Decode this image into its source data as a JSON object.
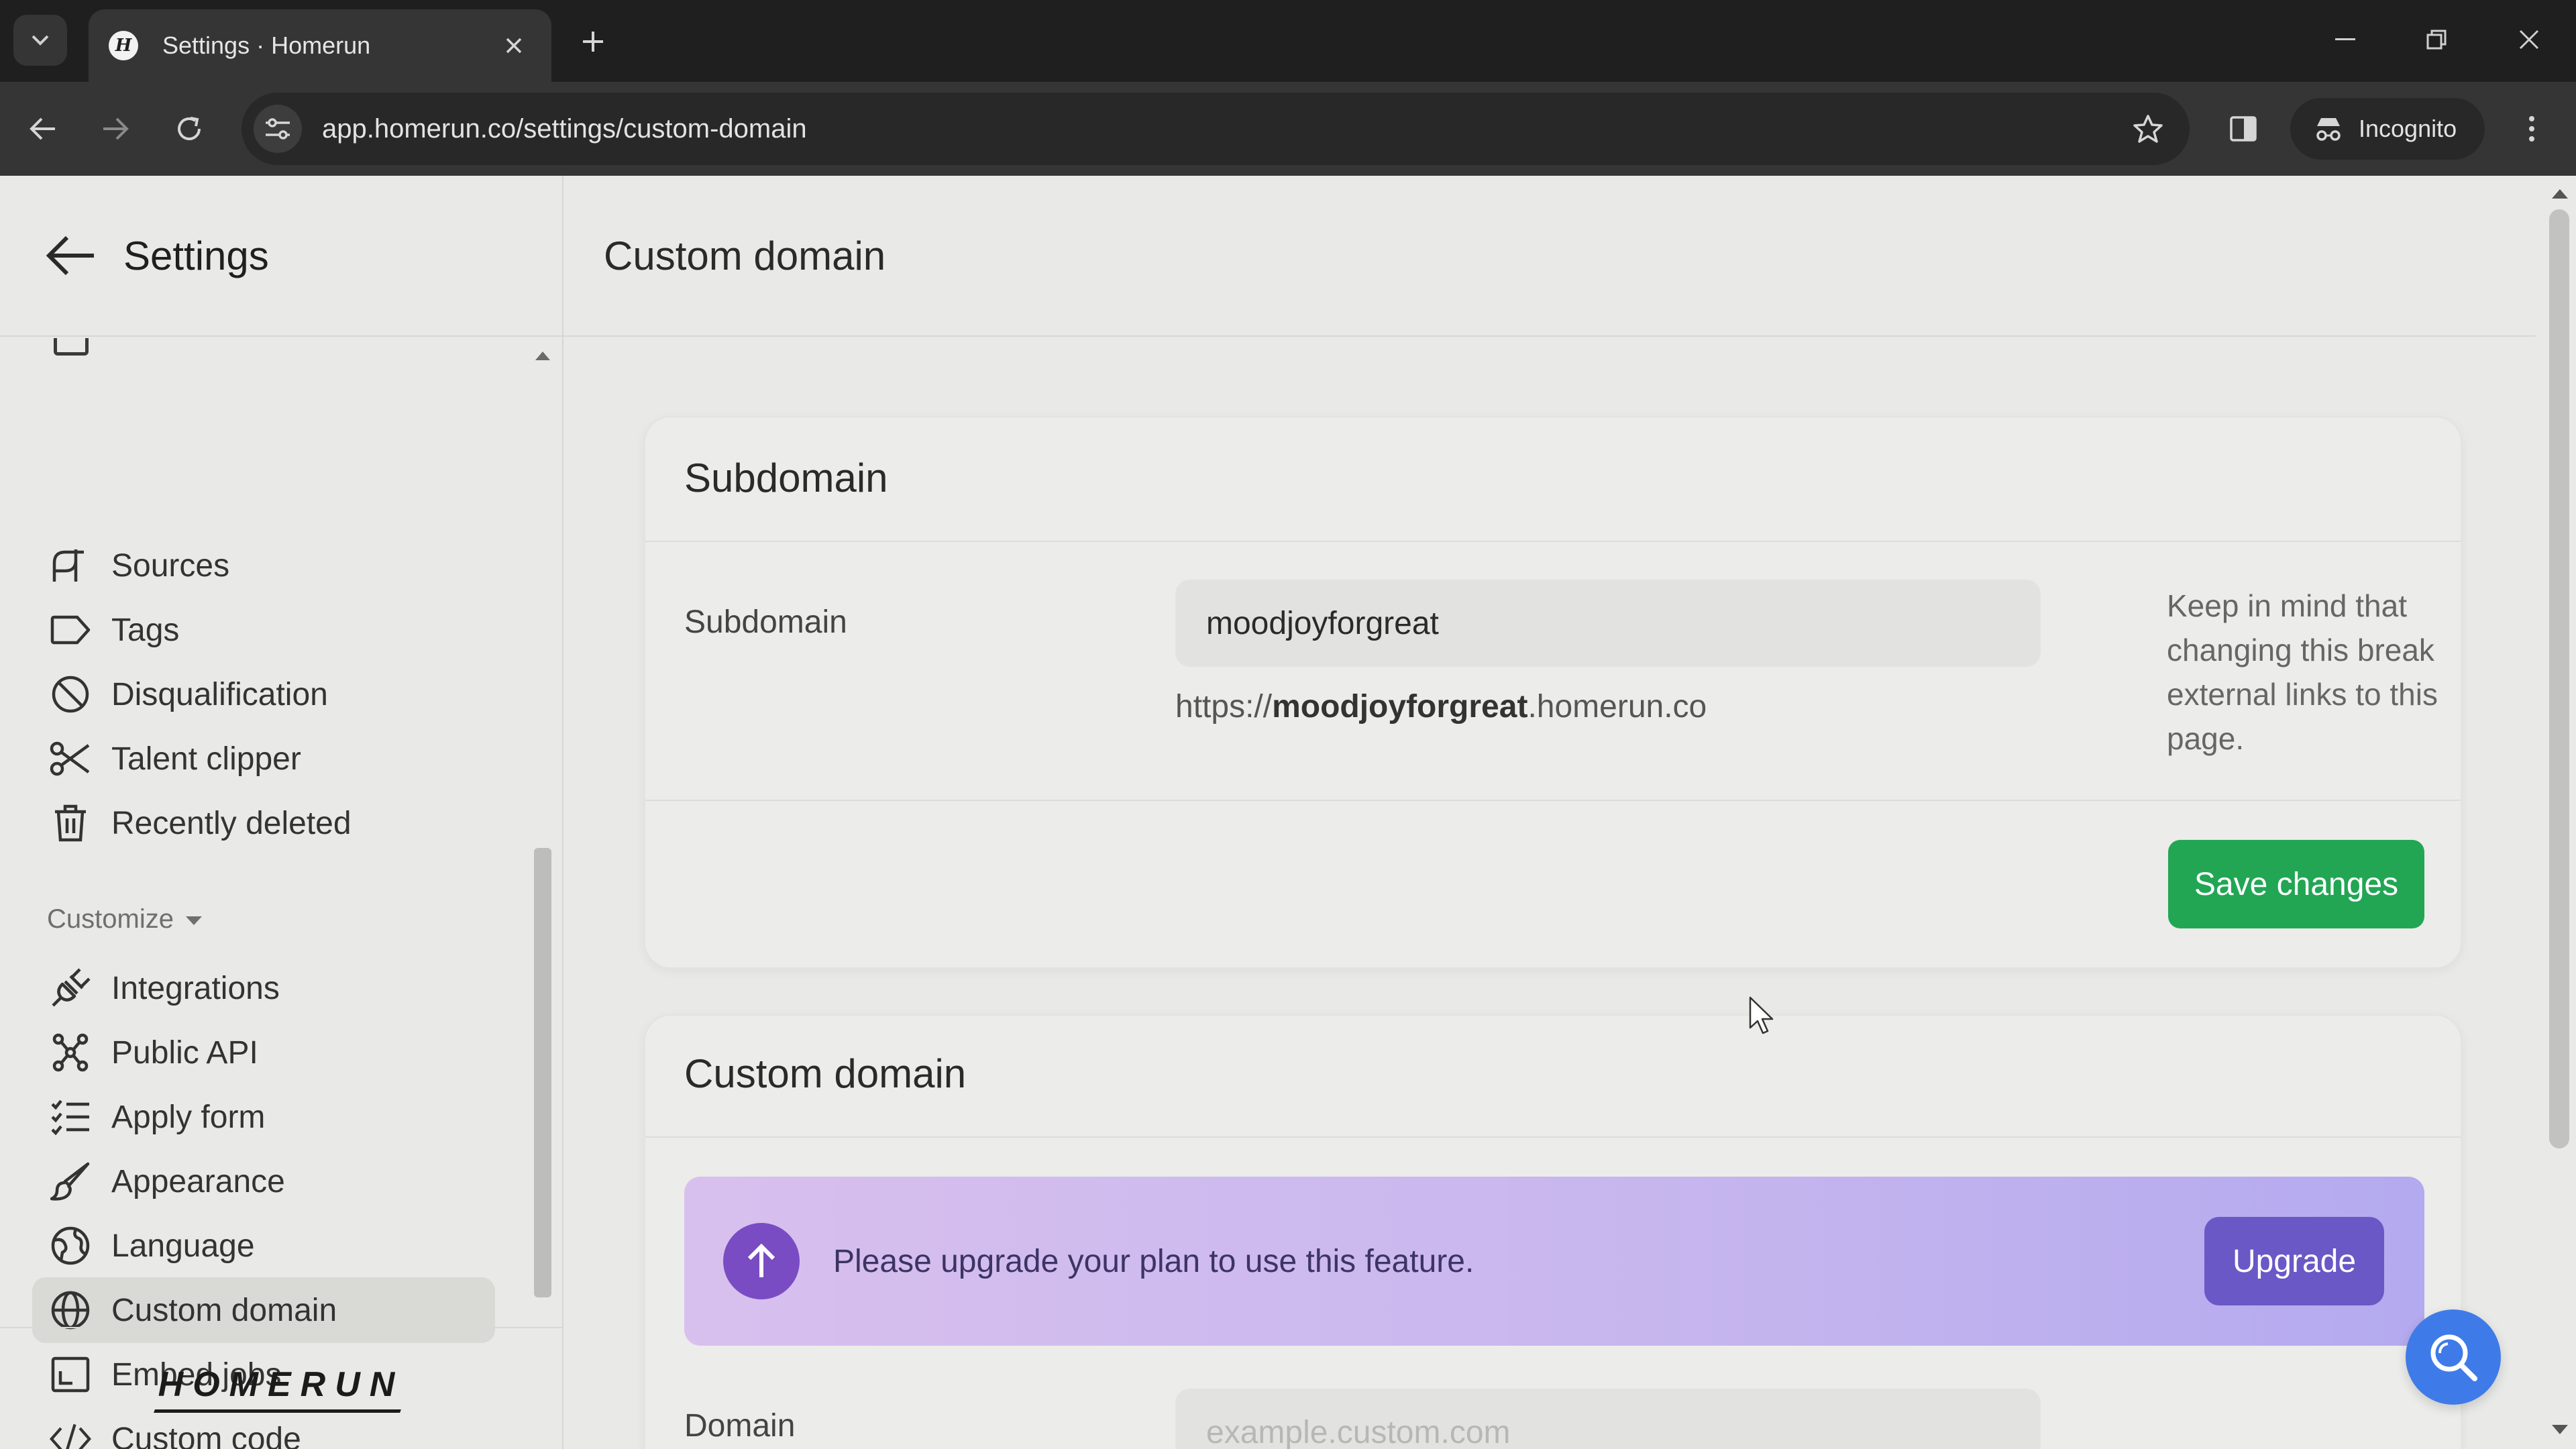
{
  "browser": {
    "tab_title": "Settings · Homerun",
    "favicon_letter": "H",
    "url": "app.homerun.co/settings/custom-domain",
    "incognito_label": "Incognito"
  },
  "sidebar": {
    "title": "Settings",
    "items": [
      {
        "label": "Sources",
        "icon": "sources-icon"
      },
      {
        "label": "Tags",
        "icon": "tag-icon"
      },
      {
        "label": "Disqualification",
        "icon": "ban-icon"
      },
      {
        "label": "Talent clipper",
        "icon": "scissors-icon"
      },
      {
        "label": "Recently deleted",
        "icon": "trash-icon"
      }
    ],
    "section_label": "Customize",
    "customize_items": [
      {
        "label": "Integrations",
        "icon": "plug-icon"
      },
      {
        "label": "Public API",
        "icon": "api-icon"
      },
      {
        "label": "Apply form",
        "icon": "checklist-icon"
      },
      {
        "label": "Appearance",
        "icon": "brush-icon"
      },
      {
        "label": "Language",
        "icon": "globe-language-icon"
      },
      {
        "label": "Custom domain",
        "icon": "globe-icon",
        "active": true
      },
      {
        "label": "Embed jobs",
        "icon": "embed-icon"
      },
      {
        "label": "Custom code",
        "icon": "code-icon"
      }
    ],
    "logo_text": "HOMERUN"
  },
  "main": {
    "page_title": "Custom domain",
    "subdomain_card": {
      "title": "Subdomain",
      "field_label": "Subdomain",
      "value": "moodjoyforgreat",
      "url_prefix": "https://",
      "url_bold": "moodjoyforgreat",
      "url_suffix": ".homerun.co",
      "hint": "Keep in mind that changing this break external links to this page.",
      "save_label": "Save changes"
    },
    "custom_domain_card": {
      "title": "Custom domain",
      "upgrade_text": "Please upgrade your plan to use this feature.",
      "upgrade_label": "Upgrade",
      "domain_label": "Domain",
      "domain_placeholder": "example.custom.com"
    }
  },
  "colors": {
    "save_button": "#22a654",
    "upgrade_button": "#6a58c6",
    "upgrade_icon": "#7a4cc3",
    "help_button": "#3f7be8"
  }
}
